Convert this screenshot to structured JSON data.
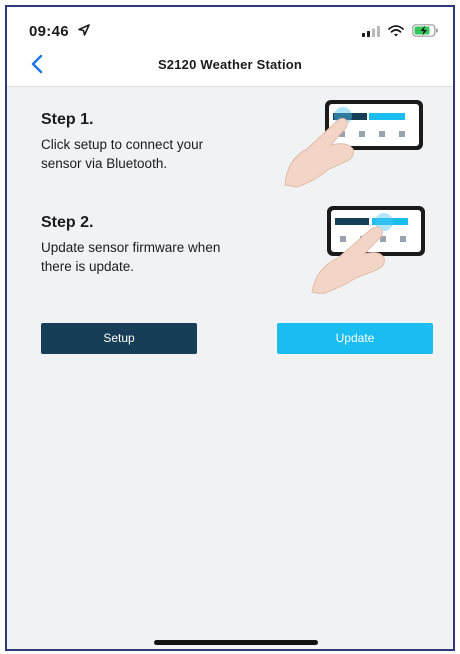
{
  "status_bar": {
    "time": "09:46"
  },
  "nav": {
    "title": "S2120 Weather Station"
  },
  "steps": [
    {
      "title": "Step 1.",
      "description": "Click setup to connect your sensor via Bluetooth."
    },
    {
      "title": "Step 2.",
      "description": "Update sensor firmware when there is update."
    }
  ],
  "buttons": {
    "setup_label": "Setup",
    "update_label": "Update"
  },
  "colors": {
    "setup_button": "#163e57",
    "update_button": "#19bdf0",
    "back_chevron": "#1a73e8",
    "background": "#f1f2f4"
  }
}
